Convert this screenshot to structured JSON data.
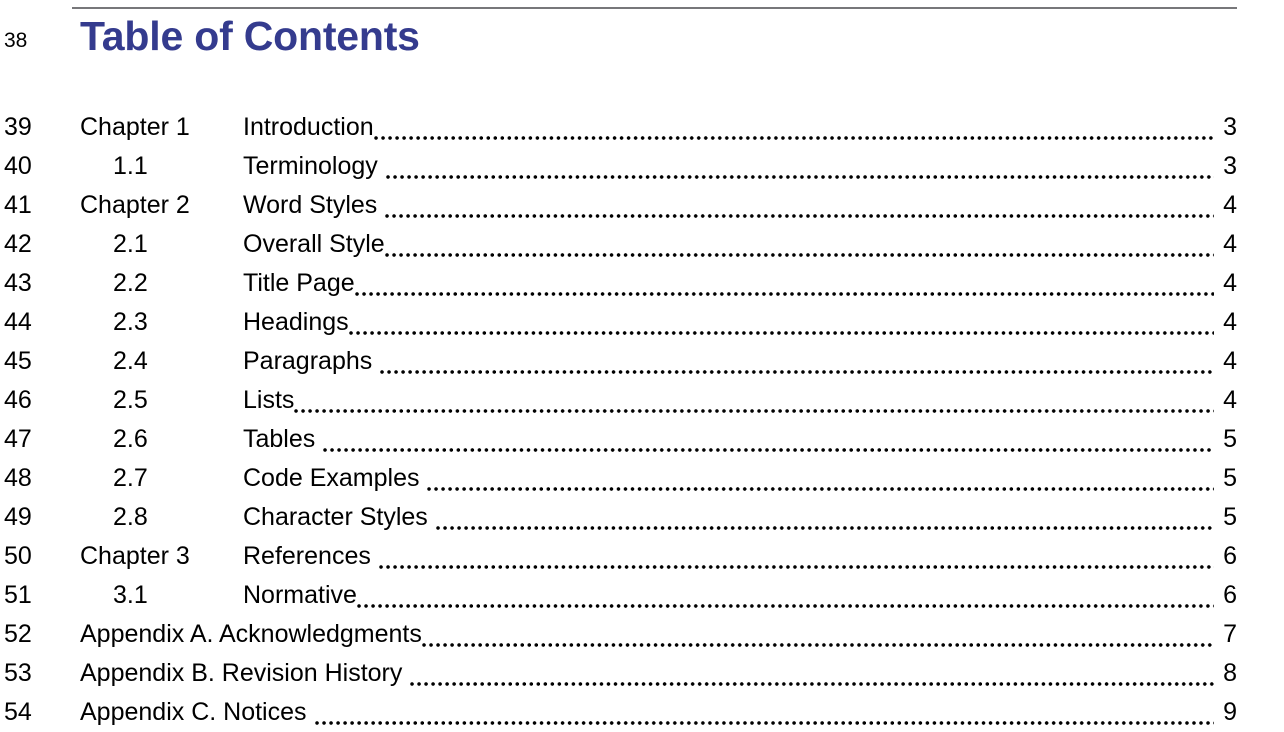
{
  "document": {
    "title": "Table of Contents",
    "title_color": "#343b8e",
    "rule_color": "#77777a",
    "text_color": "#000000",
    "background_color": "#ffffff"
  },
  "gutter": {
    "line_numbers": [
      "38",
      "39",
      "40",
      "41",
      "42",
      "43",
      "44",
      "45",
      "46",
      "47",
      "48",
      "49",
      "50",
      "51",
      "52",
      "53",
      "54"
    ]
  },
  "toc": {
    "entries": [
      {
        "line": "39",
        "number": "Chapter 1",
        "level": "chapter",
        "title": "Introduction",
        "space_before_leader": false,
        "page": "3"
      },
      {
        "line": "40",
        "number": "1.1",
        "level": "sub",
        "title": "Terminology",
        "space_before_leader": true,
        "page": "3"
      },
      {
        "line": "41",
        "number": "Chapter 2",
        "level": "chapter",
        "title": "Word Styles",
        "space_before_leader": true,
        "page": "4"
      },
      {
        "line": "42",
        "number": "2.1",
        "level": "sub",
        "title": "Overall Style",
        "space_before_leader": false,
        "page": "4"
      },
      {
        "line": "43",
        "number": "2.2",
        "level": "sub",
        "title": "Title Page",
        "space_before_leader": false,
        "page": "4"
      },
      {
        "line": "44",
        "number": "2.3",
        "level": "sub",
        "title": "Headings",
        "space_before_leader": false,
        "page": "4"
      },
      {
        "line": "45",
        "number": "2.4",
        "level": "sub",
        "title": "Paragraphs",
        "space_before_leader": true,
        "page": "4"
      },
      {
        "line": "46",
        "number": "2.5",
        "level": "sub",
        "title": "Lists",
        "space_before_leader": false,
        "page": "4"
      },
      {
        "line": "47",
        "number": "2.6",
        "level": "sub",
        "title": "Tables",
        "space_before_leader": true,
        "page": "5"
      },
      {
        "line": "48",
        "number": "2.7",
        "level": "sub",
        "title": "Code Examples",
        "space_before_leader": true,
        "page": "5"
      },
      {
        "line": "49",
        "number": "2.8",
        "level": "sub",
        "title": "Character Styles",
        "space_before_leader": true,
        "page": "5"
      },
      {
        "line": "50",
        "number": "Chapter 3",
        "level": "chapter",
        "title": "References",
        "space_before_leader": true,
        "page": "6"
      },
      {
        "line": "51",
        "number": "3.1",
        "level": "sub",
        "title": "Normative",
        "space_before_leader": false,
        "page": "6"
      },
      {
        "line": "52",
        "number": "",
        "level": "appendix",
        "title": "Appendix A. Acknowledgments",
        "space_before_leader": false,
        "page": "7"
      },
      {
        "line": "53",
        "number": "",
        "level": "appendix",
        "title": "Appendix B. Revision History",
        "space_before_leader": true,
        "page": "8"
      },
      {
        "line": "54",
        "number": "",
        "level": "appendix",
        "title": "Appendix C. Notices",
        "space_before_leader": true,
        "page": "9"
      }
    ]
  }
}
